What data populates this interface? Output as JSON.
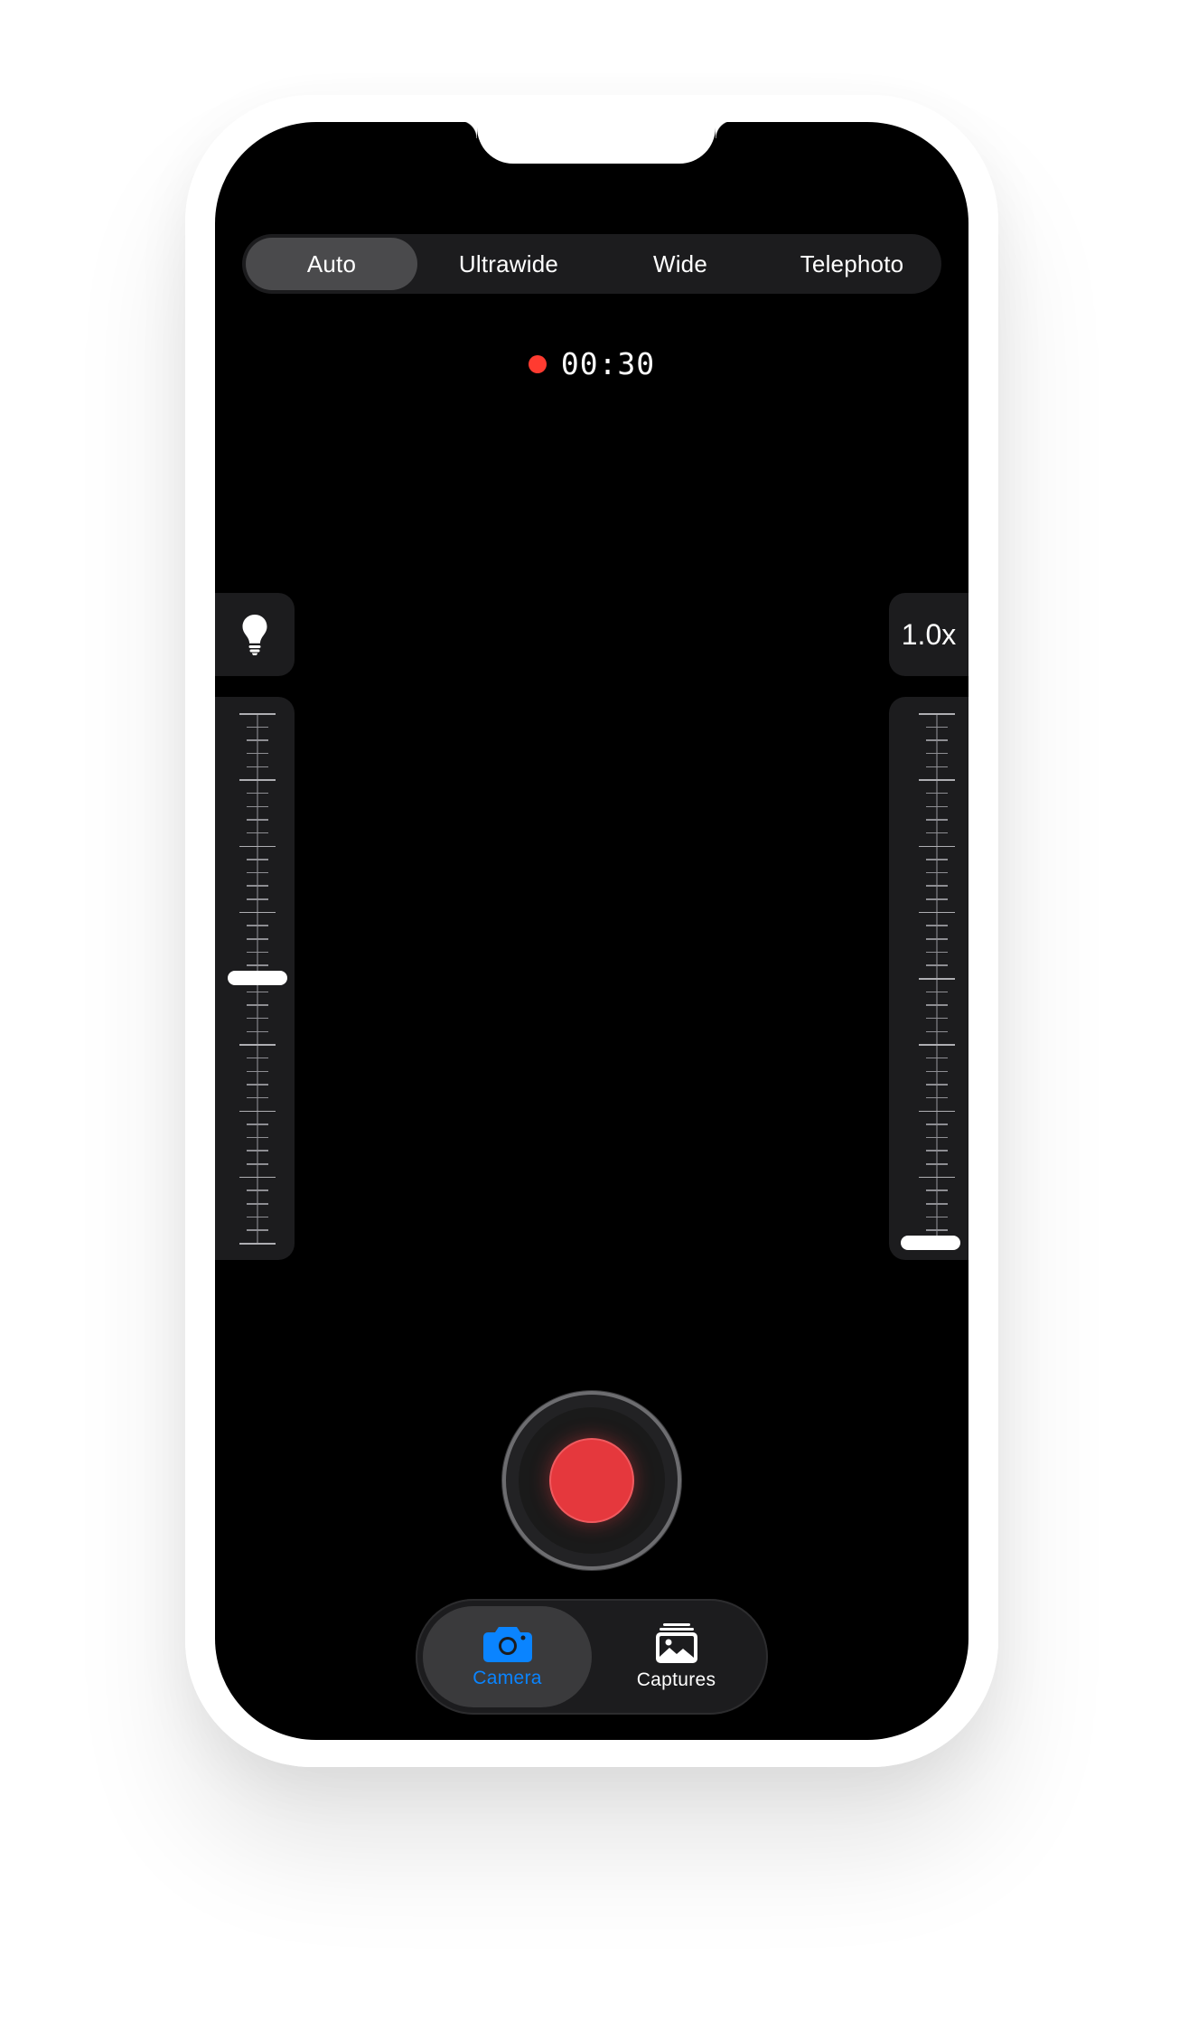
{
  "lens_selector": {
    "options": [
      "Auto",
      "Ultrawide",
      "Wide",
      "Telephoto"
    ],
    "selected": "Auto"
  },
  "recording": {
    "indicator_color": "#ff3b30",
    "elapsed": "00:30"
  },
  "left_control": {
    "icon": "lightbulb-icon",
    "slider_level": 0.5
  },
  "right_control": {
    "zoom_label": "1.0x",
    "slider_level": 0.0
  },
  "shutter": {
    "icon": "record-button",
    "color": "#e5383d"
  },
  "tabbar": {
    "tabs": [
      {
        "label": "Camera",
        "icon": "camera-icon",
        "active": true
      },
      {
        "label": "Captures",
        "icon": "photo-stack-icon",
        "active": false
      }
    ],
    "accent": "#0a84ff"
  }
}
